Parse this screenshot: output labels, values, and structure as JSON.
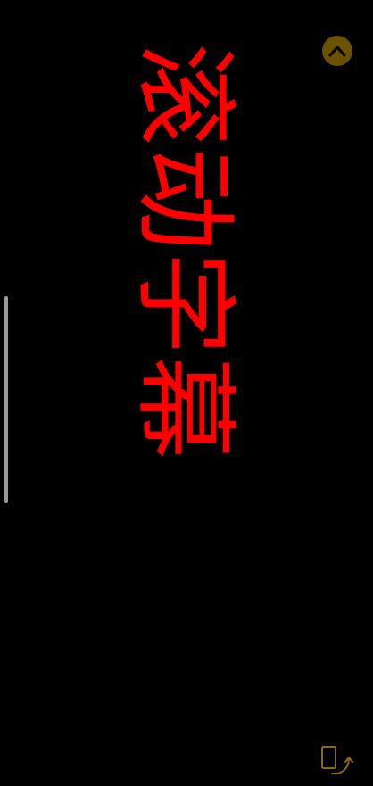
{
  "marquee": {
    "text": "滚动字幕",
    "color": "#ff0000"
  },
  "background_color": "#000000",
  "collapse_button": {
    "icon": "chevron-up-icon",
    "background_color": "#6b5200",
    "icon_color": "#000000"
  },
  "scroll_indicator": {
    "color": "#9a9a9a"
  },
  "rotate_button": {
    "icon": "screen-rotate-icon",
    "color": "#8a6a10"
  }
}
